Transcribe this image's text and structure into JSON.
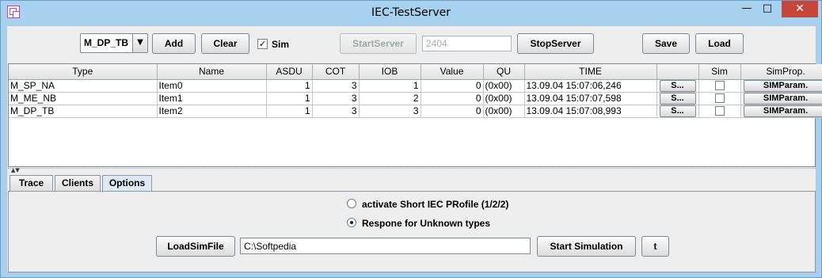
{
  "window": {
    "title": "IEC-TestServer",
    "minimize": "—",
    "maximize": "□",
    "close": "✕"
  },
  "toolbar": {
    "type_select": "M_DP_TB",
    "add": "Add",
    "clear": "Clear",
    "sim_checked": true,
    "sim_label": "Sim",
    "start_server": "StartServer",
    "port_value": "2404",
    "stop_server": "StopServer",
    "save": "Save",
    "load": "Load"
  },
  "table": {
    "columns": [
      "Type",
      "Name",
      "ASDU",
      "COT",
      "IOB",
      "Value",
      "QU",
      "TIME",
      "",
      "Sim",
      "SimProp."
    ],
    "rows": [
      {
        "type": "M_SP_NA",
        "name": "Item0",
        "asdu": "1",
        "cot": "3",
        "iob": "1",
        "value": "0",
        "qu": "(0x00)",
        "time": "13.09.04   15:07:06,246",
        "btn": "S...",
        "sim": false,
        "simprop": "SIMParam."
      },
      {
        "type": "M_ME_NB",
        "name": "Item1",
        "asdu": "1",
        "cot": "3",
        "iob": "2",
        "value": "0",
        "qu": "(0x00)",
        "time": "13.09.04   15:07:07,598",
        "btn": "S...",
        "sim": false,
        "simprop": "SIMParam."
      },
      {
        "type": "M_DP_TB",
        "name": "Item2",
        "asdu": "1",
        "cot": "3",
        "iob": "3",
        "value": "0",
        "qu": "(0x00)",
        "time": "13.09.04   15:07:08,993",
        "btn": "S...",
        "sim": false,
        "simprop": "SIMParam."
      }
    ]
  },
  "tabs": [
    {
      "label": "Trace",
      "active": false
    },
    {
      "label": "Clients",
      "active": false
    },
    {
      "label": "Options",
      "active": true
    }
  ],
  "options": {
    "radio1_label": "activate Short IEC PRofile (1/2/2)",
    "radio1_selected": false,
    "radio2_label": "Respone for Unknown types",
    "radio2_selected": true,
    "load_sim_file": "LoadSimFile",
    "path_value": "C:\\Softpedia",
    "start_simulation": "Start Simulation",
    "t_button": "t"
  }
}
